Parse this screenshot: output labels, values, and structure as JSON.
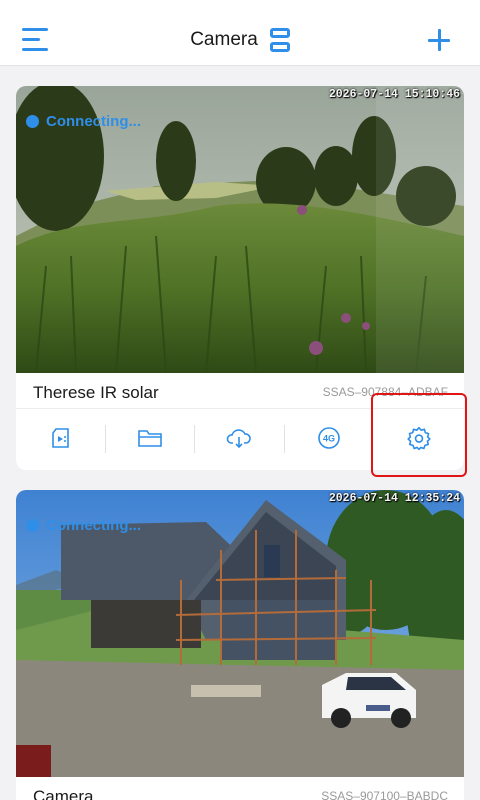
{
  "header": {
    "title": "Camera",
    "menu_icon": "hamburger-menu-icon",
    "layout_icon": "layout-toggle-icon",
    "add_icon": "plus-icon",
    "accent_color": "#2f8fe8"
  },
  "cameras": [
    {
      "timestamp": "2026-07-14 15:10:46",
      "status": "Connecting...",
      "name": "Therese IR solar",
      "device_id": "SSAS–907884–ADBAF"
    },
    {
      "timestamp": "2026-07-14 12:35:24",
      "status": "Connecting...",
      "name": "Camera",
      "device_id": "SSAS–907100–BABDC"
    }
  ],
  "toolbar": {
    "icons": [
      "sd-card-playback-icon",
      "folder-icon",
      "cloud-download-icon",
      "4g-icon",
      "settings-gear-icon"
    ],
    "label_4g": "4G"
  },
  "highlight_color": "#e01616"
}
